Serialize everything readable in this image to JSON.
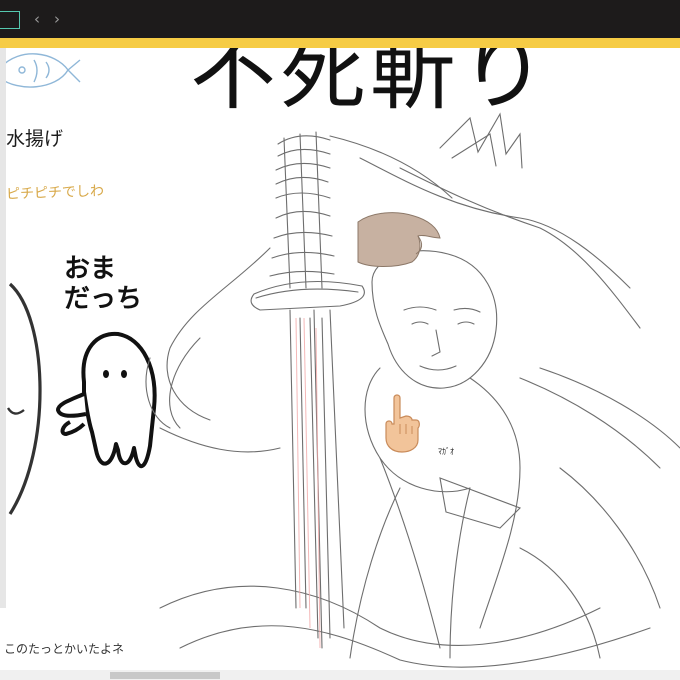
{
  "window": {
    "nav_back": "‹",
    "nav_forward": "›",
    "accent_color": "#f6cc45",
    "titlebar_color": "#1d1b1b",
    "tab_outline_color": "#55c9b0"
  },
  "canvas": {
    "title_text": "不死斬り",
    "note_blue": "水揚げ",
    "note_yellow": "ピチピチでしわ",
    "character_label_line1": "おま",
    "character_label_line2": "だっち",
    "small_text": "ﾏｶﾞｵ",
    "bottom_note": "このたっとかいたよネ"
  },
  "icons": {
    "hover_hand": "hand-grab-icon",
    "pointer_hand": "hand-point-up-icon"
  }
}
